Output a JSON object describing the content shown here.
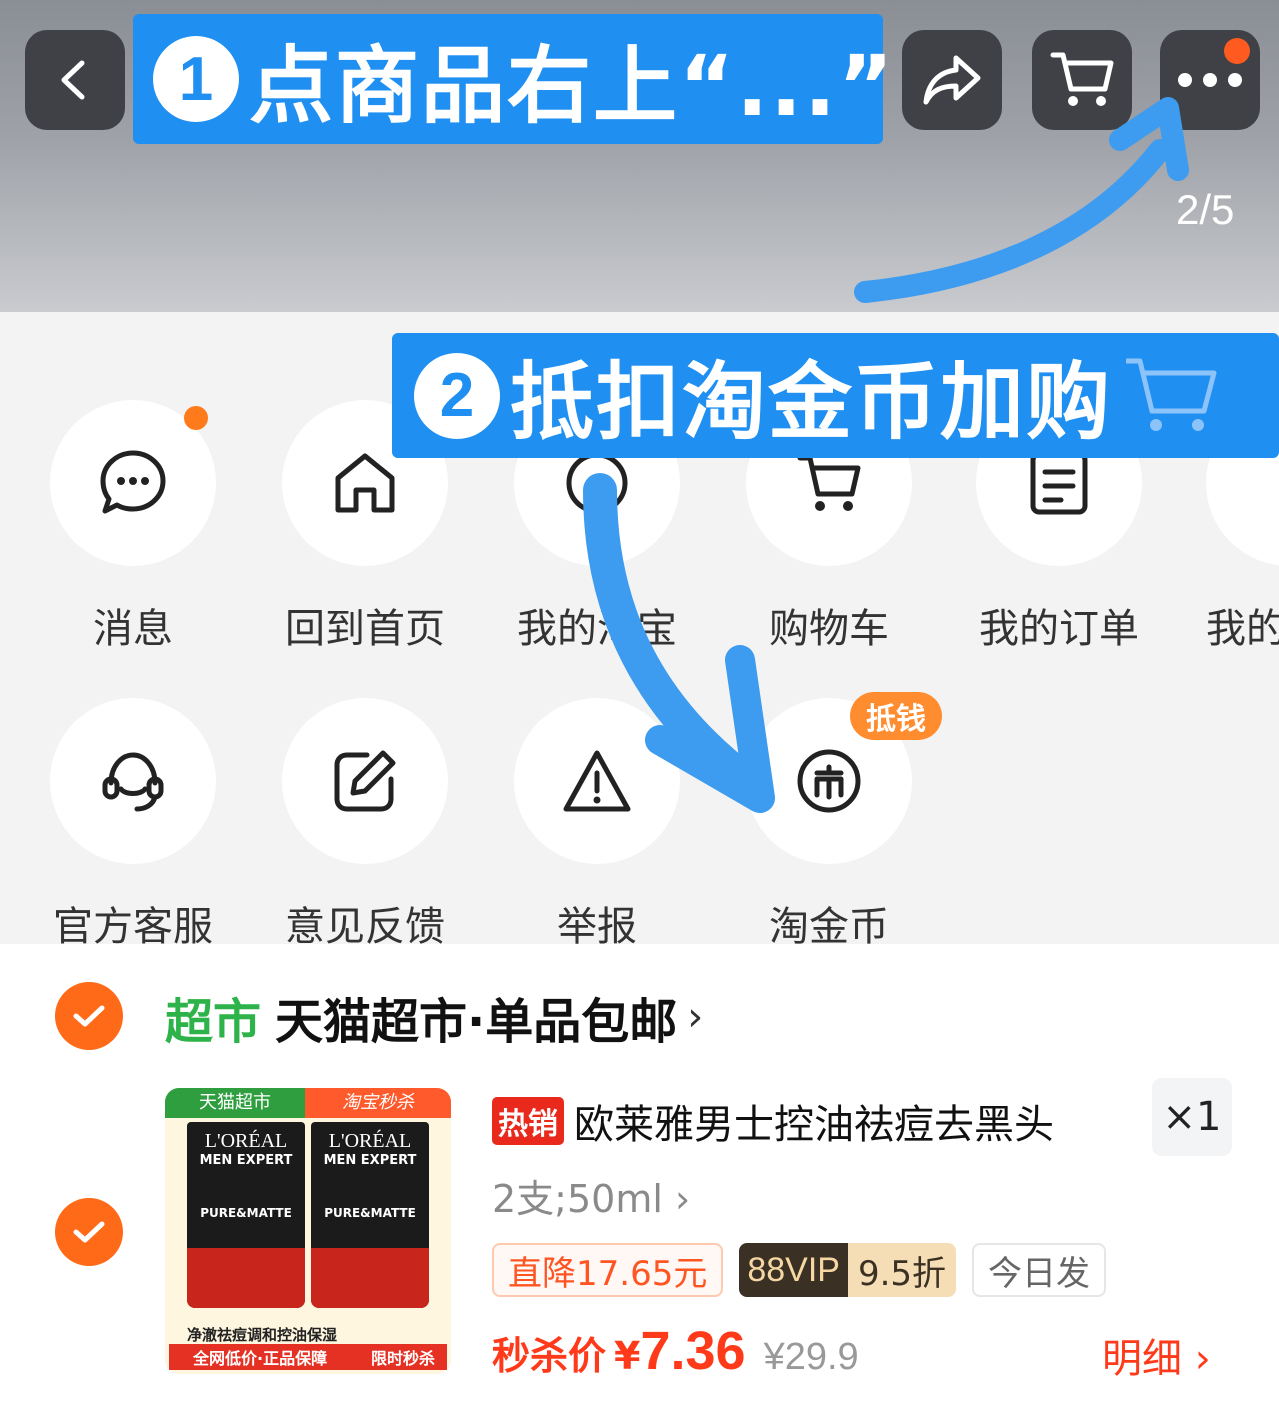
{
  "header": {
    "page_indicator": "2/5",
    "icons": [
      "back-icon",
      "share-icon",
      "cart-icon",
      "more-icon"
    ]
  },
  "annotations": {
    "step1_number": "1",
    "step1_text": "点商品右上“...”",
    "step2_number": "2",
    "step2_text": "抵扣淘金币加购"
  },
  "menu": {
    "row1": [
      {
        "label": "消息",
        "icon": "message-icon"
      },
      {
        "label": "回到首页",
        "icon": "home-icon"
      },
      {
        "label": "我的淘宝",
        "icon": "profile-icon"
      },
      {
        "label": "购物车",
        "icon": "cart-icon"
      },
      {
        "label": "我的订单",
        "icon": "order-icon"
      },
      {
        "label": "我的",
        "icon": "more-icon"
      }
    ],
    "row2": [
      {
        "label": "官方客服",
        "icon": "headset-icon"
      },
      {
        "label": "意见反馈",
        "icon": "edit-icon"
      },
      {
        "label": "举报",
        "icon": "warning-icon"
      },
      {
        "label": "淘金币",
        "icon": "coin-icon"
      }
    ],
    "coin_badge": "抵钱"
  },
  "store": {
    "tag": "超市",
    "name": "天猫超市·单品包邮",
    "arrow": "›"
  },
  "product": {
    "image": {
      "header_left": "天猫超市",
      "header_right": "淘宝秒杀",
      "brand": "L'ORÉAL",
      "sub": "MEN EXPERT",
      "variant": "PURE&MATTE",
      "foot1": "净澈祛痘调和控油保湿",
      "foot2_left": "全网低价·正品保障",
      "foot2_right": "限时秒杀"
    },
    "hot_tag": "热销",
    "title": "欧莱雅男士控油祛痘去黑头",
    "quantity": "×1",
    "spec": "2支;50ml ›",
    "tag_drop": "直降17.65元",
    "vip_label": "88VIP",
    "vip_discount": "9.5折",
    "tag_today": "今日发",
    "price_label": "秒杀价",
    "currency": "¥",
    "price": "7.36",
    "original_price": "¥29.9",
    "detail": "明细 ›"
  },
  "colors": {
    "accent_blue": "#1f8ff2",
    "orange": "#ff6a18",
    "price_red": "#ff3a1a",
    "store_green": "#2db34a"
  }
}
